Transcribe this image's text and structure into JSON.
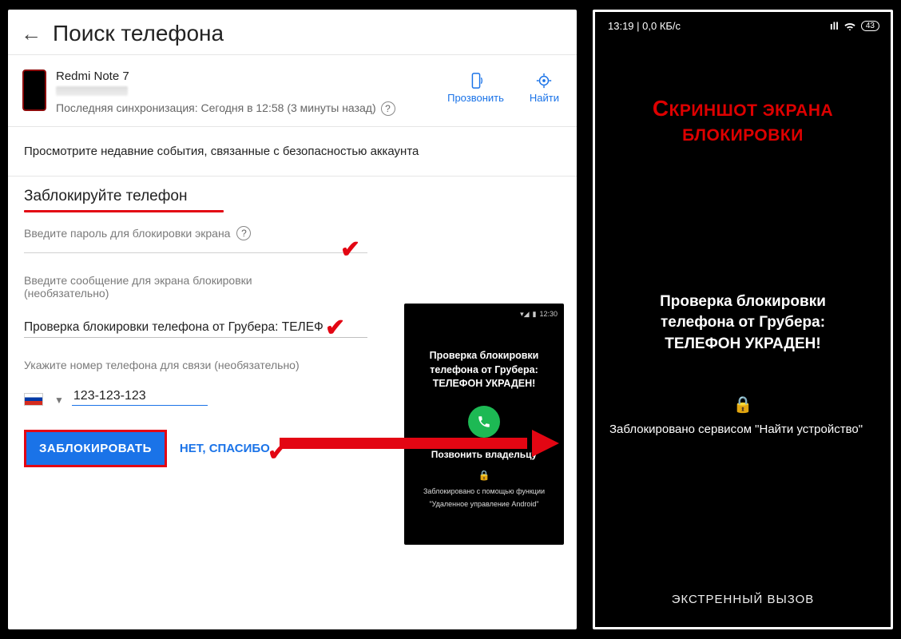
{
  "left": {
    "title": "Поиск телефона",
    "device": {
      "name": "Redmi Note 7",
      "sync": "Последняя синхронизация: Сегодня в 12:58 (3 минуты назад)"
    },
    "actions": {
      "ring": "Прозвонить",
      "find": "Найти"
    },
    "events": "Просмотрите недавние события, связанные с безопасностью аккаунта",
    "lock": {
      "heading": "Заблокируйте телефон",
      "pw_label": "Введите пароль для блокировки экрана",
      "msg_label_1": "Введите сообщение для экрана блокировки",
      "msg_label_2": "(необязательно)",
      "msg_value": "Проверка блокировки телефона от Грубера: ТЕЛЕФ",
      "phone_label": "Укажите номер телефона для связи (необязательно)",
      "phone_value": "123-123-123"
    },
    "buttons": {
      "lock": "ЗАБЛОКИРОВАТЬ",
      "no": "НЕТ, СПАСИБО"
    },
    "mini": {
      "status_time": "12:30",
      "msg_l1": "Проверка блокировки",
      "msg_l2": "телефона от Грубера:",
      "msg_l3": "ТЕЛЕФОН УКРАДЕН!",
      "owner": "Позвонить владельцу",
      "sub1": "Заблокировано с помощью функции",
      "sub2": "\"Удаленное управление Android\""
    }
  },
  "right": {
    "status_time": "13:19 | 0,0 КБ/с",
    "battery": "43",
    "red_title_1": "Скриншот экрана",
    "red_title_2": "блокировки",
    "msg_l1": "Проверка блокировки",
    "msg_l2": "телефона от Грубера:",
    "msg_l3": "ТЕЛЕФОН УКРАДЕН!",
    "blocked": "Заблокировано сервисом \"Найти устройство\"",
    "emergency": "ЭКСТРЕННЫЙ ВЫЗОВ"
  }
}
